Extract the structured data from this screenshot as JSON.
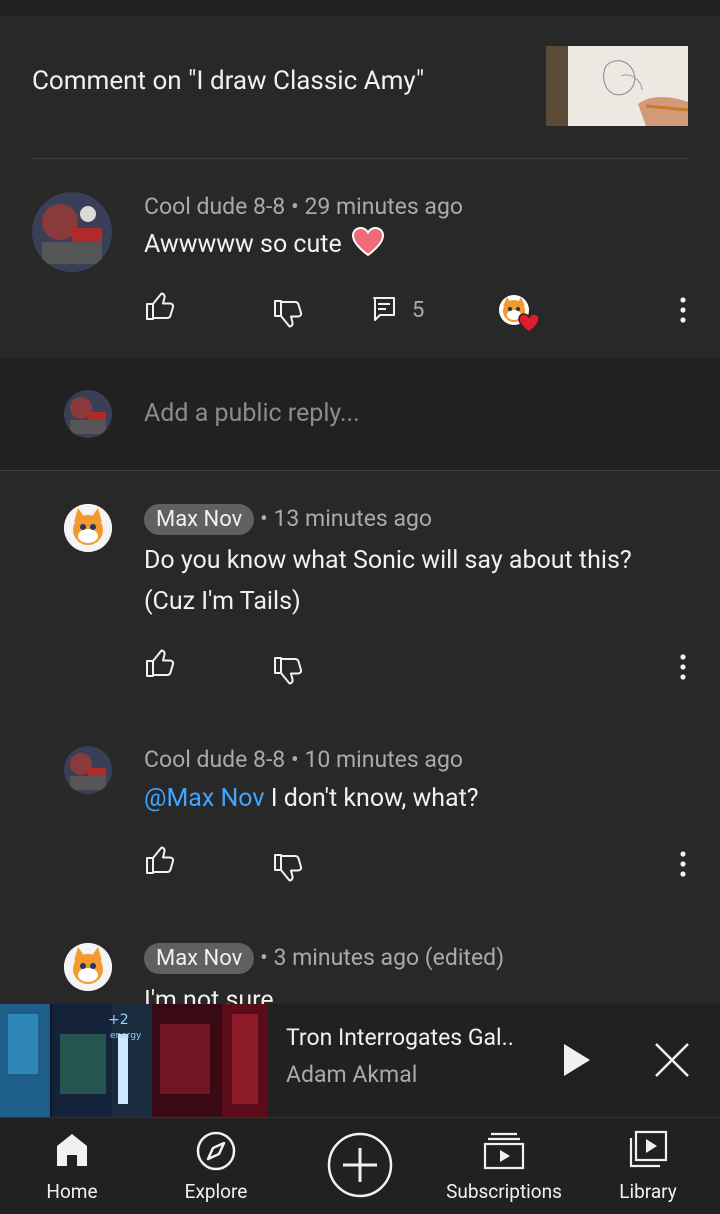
{
  "header": {
    "title": "Comment on \"I draw Classic Amy\""
  },
  "main_comment": {
    "author": "Cool dude 8-8",
    "time": "29 minutes ago",
    "text": "Awwwww so cute",
    "reply_count": "5"
  },
  "reply_box": {
    "placeholder": "Add a public reply..."
  },
  "replies": [
    {
      "author": "Max Nov",
      "time": "13 minutes ago",
      "line1": "Do you know what Sonic will say about this?",
      "line2": "(Cuz I'm Tails)"
    },
    {
      "author": "Cool dude 8-8",
      "time": "10 minutes ago",
      "mention": "@Max Nov",
      "text": "I don't know, what?"
    },
    {
      "author": "Max Nov",
      "time": "3 minutes ago (edited)",
      "text": "I'm not sure..."
    }
  ],
  "mini_player": {
    "title": "Tron Interrogates Gal..",
    "channel": "Adam Akmal",
    "thumb_overlay": "+2",
    "thumb_label": "energy"
  },
  "bottom_nav": {
    "home": "Home",
    "explore": "Explore",
    "subscriptions": "Subscriptions",
    "library": "Library"
  },
  "meta_separator": "•",
  "colors": {
    "background": "#282828",
    "accent_link": "#3ea6ff",
    "heart": "#ff4e6a",
    "chip": "#606060"
  }
}
